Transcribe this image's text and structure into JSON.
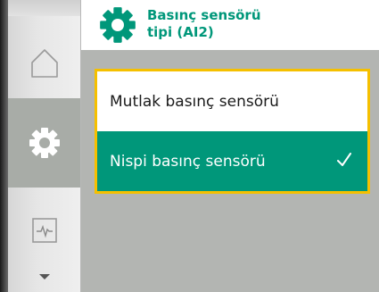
{
  "nav": {
    "items": [
      {
        "icon": "home-icon",
        "selected": false
      },
      {
        "icon": "gear-icon",
        "selected": true
      },
      {
        "icon": "monitor-icon",
        "selected": false
      }
    ],
    "scroll_icon": "scroll-down-icon"
  },
  "header": {
    "icon": "gear-icon",
    "title": "Basınç sensörü\ntipi (AI2)"
  },
  "options": [
    {
      "label": "Mutlak basınç sensörü",
      "selected": false
    },
    {
      "label": "Nispi basınç sensörü",
      "selected": true
    }
  ],
  "colors": {
    "accent_green": "#00977a",
    "focus_yellow": "#f5c000",
    "content_bg": "#b3b5b2"
  }
}
